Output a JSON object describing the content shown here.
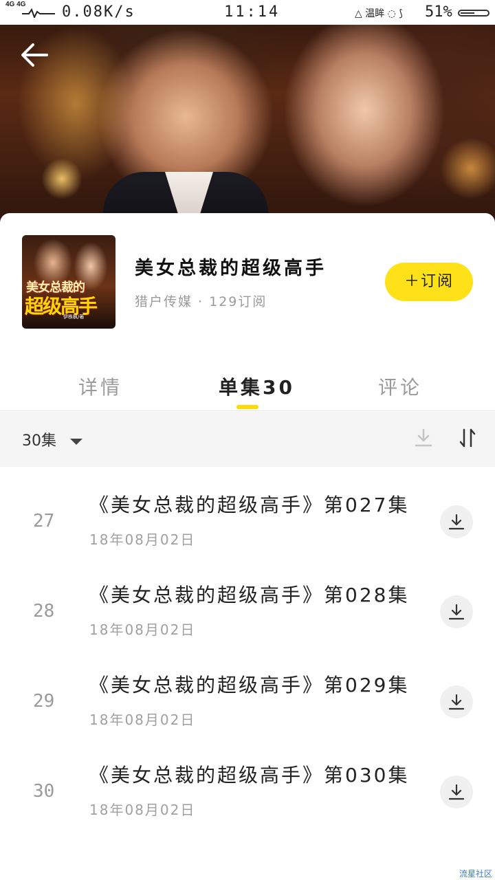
{
  "status_bar": {
    "signal": "4G 4G",
    "net_speed": "0.08K/s",
    "time": "11:14",
    "right_icons": "△ 温眸 ◌ ⟆",
    "battery": "51%"
  },
  "hero": {
    "back_icon": "back-arrow-icon"
  },
  "book": {
    "cover_line1": "美女总裁的",
    "cover_line2": "超级高手",
    "cover_author": "伊株枫/著",
    "title": "美女总裁的超级高手",
    "meta": "猎户传媒 · 129订阅",
    "subscribe_label": "＋订阅"
  },
  "tabs": [
    {
      "label": "详情",
      "active": false
    },
    {
      "label": "单集30",
      "active": true
    },
    {
      "label": "评论",
      "active": false
    }
  ],
  "toolbar": {
    "filter_label": "30集",
    "download_icon": "download-icon",
    "sort_icon": "sort-icon"
  },
  "episodes": [
    {
      "num": "27",
      "title": "《美女总裁的超级高手》第027集",
      "date": "18年08月02日"
    },
    {
      "num": "28",
      "title": "《美女总裁的超级高手》第028集",
      "date": "18年08月02日"
    },
    {
      "num": "29",
      "title": "《美女总裁的超级高手》第029集",
      "date": "18年08月02日"
    },
    {
      "num": "30",
      "title": "《美女总裁的超级高手》第030集",
      "date": "18年08月02日"
    }
  ],
  "watermark": "流星社区",
  "colors": {
    "accent": "#ffe11a",
    "indicator": "#ffd800",
    "muted": "#9a9a9a"
  }
}
